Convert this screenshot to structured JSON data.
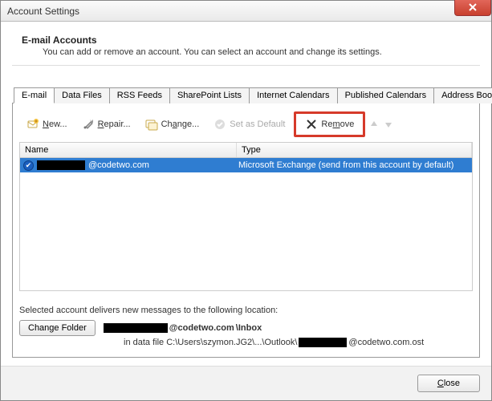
{
  "window": {
    "title": "Account Settings"
  },
  "heading": {
    "title": "E-mail Accounts",
    "subtitle": "You can add or remove an account. You can select an account and change its settings."
  },
  "tabs": [
    {
      "label": "E-mail",
      "active": true
    },
    {
      "label": "Data Files"
    },
    {
      "label": "RSS Feeds"
    },
    {
      "label": "SharePoint Lists"
    },
    {
      "label": "Internet Calendars"
    },
    {
      "label": "Published Calendars"
    },
    {
      "label": "Address Books"
    }
  ],
  "toolbar": {
    "new": "New...",
    "repair": "Repair...",
    "change": "Change...",
    "set_default": "Set as Default",
    "remove": "Remove"
  },
  "list": {
    "col_name": "Name",
    "col_type": "Type",
    "row": {
      "name_suffix": "@codetwo.com",
      "type": "Microsoft Exchange (send from this account by default)"
    }
  },
  "deliver": {
    "label": "Selected account delivers new messages to the following location:",
    "change_folder": "Change Folder",
    "path_mid": "@codetwo.com",
    "path_end": "\\Inbox",
    "datafile_prefix": "in data file C:\\Users\\szymon.JG2\\...\\Outlook\\",
    "datafile_suffix": "@codetwo.com.ost"
  },
  "footer": {
    "close": "Close"
  }
}
